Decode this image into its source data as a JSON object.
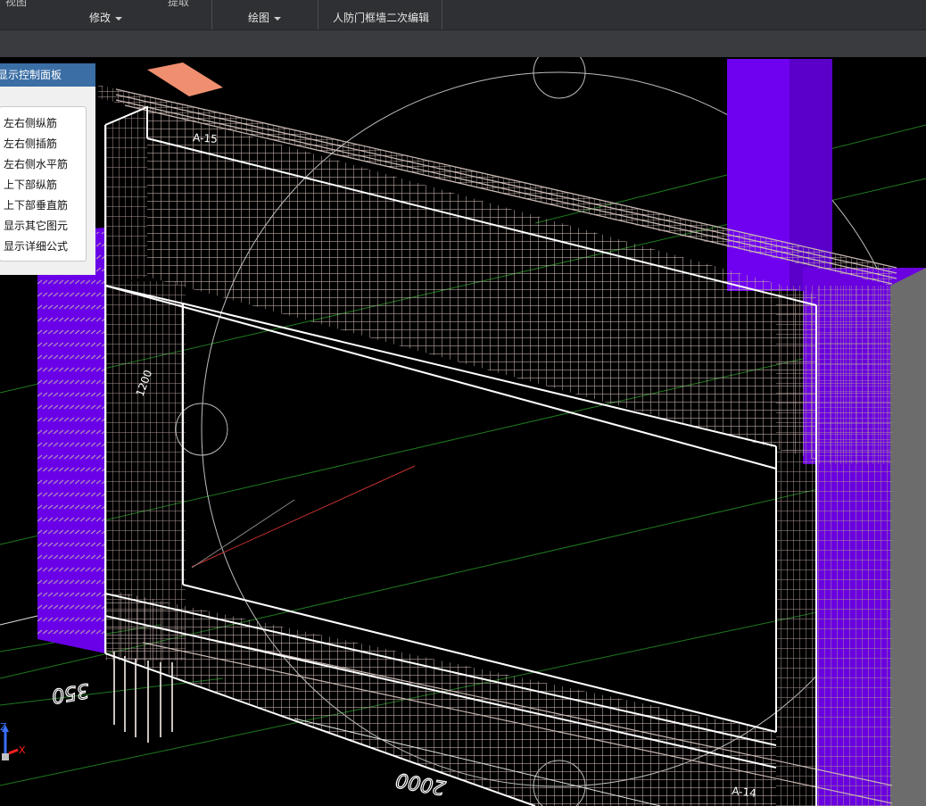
{
  "ribbon": {
    "top_cut_left": "视图",
    "top_cut_right": "提取",
    "group_modify": "修改",
    "group_draw": "绘图",
    "group_civil": "人防门框墙二次编辑"
  },
  "panel": {
    "title": "显示控制面板",
    "items": [
      "左右侧纵筋",
      "左右侧插筋",
      "左右侧水平筋",
      "上下部纵筋",
      "上下部垂直筋",
      "显示其它图元",
      "显示详细公式"
    ]
  },
  "scene": {
    "label_top": "A-15",
    "label_left": "1200",
    "label_bottom_right": "A-14",
    "dim_left": "350",
    "dim_bottom": "2000"
  },
  "axis": {
    "z": "Z",
    "x": "X"
  },
  "colors": {
    "column": "#6b00e6",
    "rebar": "#b7a49e",
    "frame": "#ffffff",
    "grid": "#2e8b2e",
    "ribbon": "#2f3033"
  }
}
